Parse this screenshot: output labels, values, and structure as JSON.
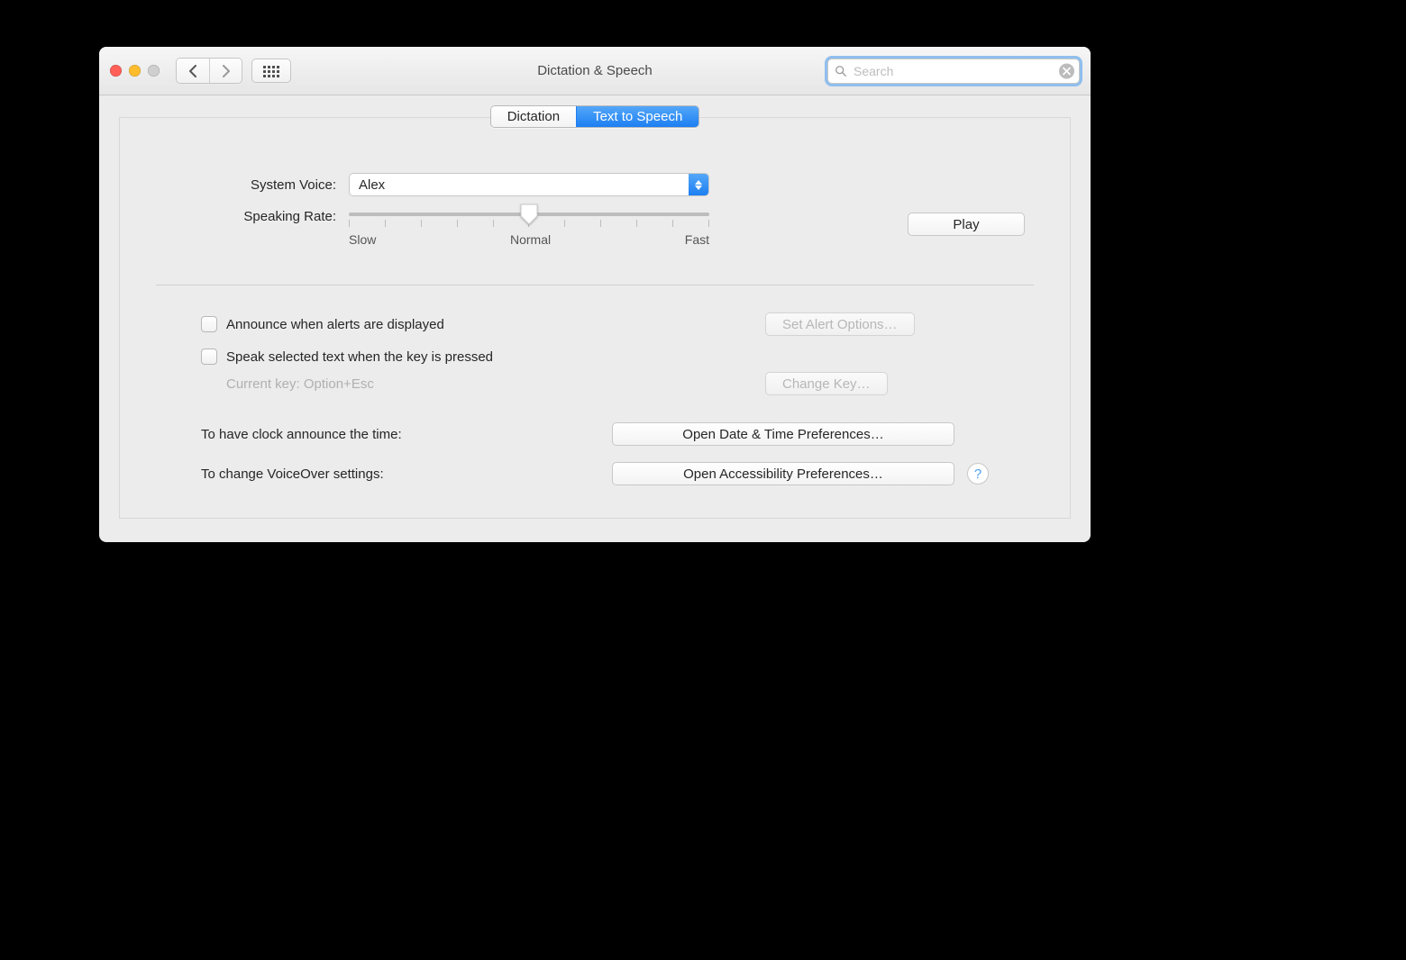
{
  "window": {
    "title": "Dictation & Speech"
  },
  "search": {
    "placeholder": "Search"
  },
  "tabs": {
    "dictation": "Dictation",
    "tts": "Text to Speech"
  },
  "voice": {
    "label": "System Voice:",
    "selected": "Alex"
  },
  "rate": {
    "label": "Speaking Rate:",
    "slow": "Slow",
    "normal": "Normal",
    "fast": "Fast"
  },
  "play": "Play",
  "checks": {
    "announce_alerts": "Announce when alerts are displayed",
    "speak_selected": "Speak selected text when the key is pressed",
    "current_key": "Current key: Option+Esc"
  },
  "buttons": {
    "set_alert": "Set Alert Options…",
    "change_key": "Change Key…",
    "open_datetime": "Open Date & Time Preferences…",
    "open_accessibility": "Open Accessibility Preferences…"
  },
  "links": {
    "clock": "To have clock announce the time:",
    "voiceover": "To change VoiceOver settings:"
  }
}
